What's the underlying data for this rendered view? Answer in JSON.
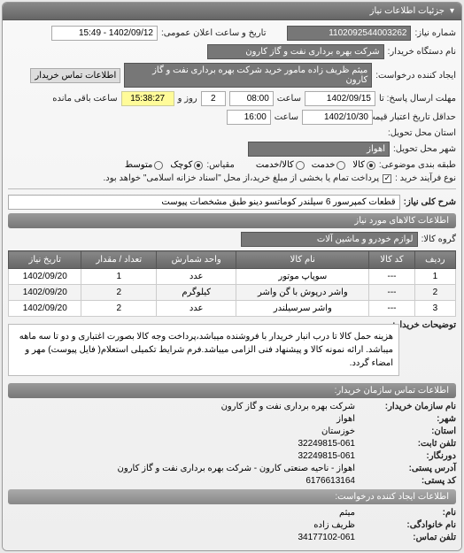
{
  "header": {
    "title": "جزئیات اطلاعات نیاز"
  },
  "top": {
    "req_no_label": "شماره نیاز:",
    "req_no": "1102092544003262",
    "announce_date_label": "تاریخ و ساعت اعلان عمومی:",
    "announce_date": "1402/09/12 - 15:49",
    "device_name_label": "نام دستگاه خریدار:",
    "device_name": "شرکت بهره برداری نفت و گاز کارون",
    "requester_label": "ایجاد کننده درخواست:",
    "requester": "میثم ظریف زاده مامور خرید شرکت بهره برداری نفت و گاز کارون",
    "contact_btn": "اطلاعات تماس خریدار",
    "reply_deadline_label": "مهلت ارسال پاسخ: تا",
    "reply_date": "1402/09/15",
    "time_label": "ساعت",
    "reply_time": "08:00",
    "days_remain": "2",
    "days_remain_suffix": "روز و",
    "countdown": "15:38:27",
    "countdown_suffix": "ساعت باقی مانده",
    "validity_label": "حداقل تاریخ اعتبار قیمت: تا تاریخ:",
    "validity_date": "1402/10/30",
    "validity_time": "16:00",
    "delivery_loc_label": "استان محل تحویل:",
    "delivery_city_label": "شهر محل تحویل:",
    "delivery_city": "اهواز",
    "package_label": "طبقه بندی موضوعی:",
    "r1": "کالا",
    "r2": "خدمت",
    "r3": "کالا/خدمت",
    "scale_label": "مقیاس:",
    "s1": "کوچک",
    "s2": "متوسط",
    "purchase_type_label": "نوع فرآیند خرید :",
    "purchase_type_note": "پرداخت تمام یا بخشی از مبلغ خرید،از محل \"اسناد خزانه اسلامی\" خواهد بود."
  },
  "need": {
    "title_label": "شرح کلی نیاز:",
    "title_text": "قطعات کمپرسور 6 سیلندر کوماتسو دینو طبق مشخصات پیوست"
  },
  "goods_section": {
    "header": "اطلاعات کالاهای مورد نیاز",
    "group_label": "گروه کالا:",
    "group_value": "لوازم خودرو و ماشین آلات"
  },
  "table": {
    "cols": {
      "row": "ردیف",
      "code": "کد کالا",
      "name": "نام کالا",
      "unit": "واحد شمارش",
      "qty": "تعداد / مقدار",
      "date": "تاریخ نیاز"
    },
    "rows": [
      {
        "n": "1",
        "code": "---",
        "name": "سوپاپ موتور",
        "unit": "عدد",
        "qty": "1",
        "date": "1402/09/20"
      },
      {
        "n": "2",
        "code": "---",
        "name": "واشر درپوش با گن واشر",
        "unit": "کیلوگرم",
        "qty": "2",
        "date": "1402/09/20"
      },
      {
        "n": "3",
        "code": "---",
        "name": "واشر سرسیلندر",
        "unit": "عدد",
        "qty": "2",
        "date": "1402/09/20"
      }
    ]
  },
  "explain": {
    "label": "توضیحات خریدار:",
    "text": "هزینه حمل کالا تا درب انبار خریدار با فروشنده میباشد،پرداخت وجه کالا بصورت اغتباری و دو تا سه ماهه میباشد. ارائه نمونه کالا و پیشنهاد فنی الزامی میباشد.فرم شرایط تکمیلی استعلام( فایل پیوست) مهر و امضاء گردد."
  },
  "contact_section": {
    "header": "اطلاعات تماس سازمان خریدار:",
    "org_label": "نام سازمان خریدار:",
    "org": "شرکت بهره برداری نفت و گاز کارون",
    "city_label": "شهر:",
    "city": "اهواز",
    "province_label": "استان:",
    "province": "خوزستان",
    "phone_label": "تلفن ثابت:",
    "phone": "32249815-061",
    "fax_label": "دورنگار:",
    "fax": "32249815-061",
    "postal_label": "آدرس پستی:",
    "postal": "اهواز - ناحیه صنعتی کارون - شرکت بهره برداری نفت و گاز کارون",
    "zip_label": "کد پستی:",
    "zip": "6176613164",
    "creator_header": "اطلاعات ایجاد کننده درخواست:",
    "fname_label": "نام:",
    "fname": "میثم",
    "lname_label": "نام خانوادگی:",
    "lname": "ظریف زاده",
    "tel_label": "تلفن تماس:",
    "tel": "34177102-061"
  }
}
